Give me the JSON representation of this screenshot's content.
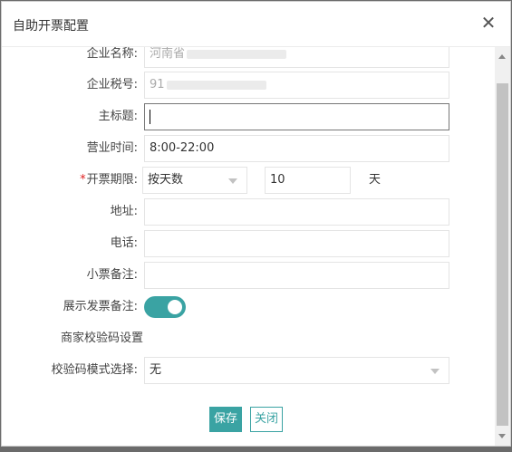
{
  "dialog": {
    "title": "自助开票配置",
    "close_icon": "✕"
  },
  "form": {
    "company_name": {
      "label": "企业名称:",
      "value": "河南省",
      "disabled": true
    },
    "tax_number": {
      "label": "企业税号:",
      "value": "91",
      "disabled": true
    },
    "main_title": {
      "label": "主标题:",
      "value": ""
    },
    "business_hours": {
      "label": "营业时间:",
      "value": "8:00-22:00"
    },
    "invoice_period": {
      "required_mark": "*",
      "label": "开票期限:",
      "mode": "按天数",
      "count": "10",
      "unit": "天"
    },
    "address": {
      "label": "地址:",
      "value": ""
    },
    "phone": {
      "label": "电话:",
      "value": ""
    },
    "receipt_note": {
      "label": "小票备注:",
      "value": ""
    },
    "show_invoice_note": {
      "label": "展示发票备注:",
      "on": true
    },
    "merchant_code_section": "商家校验码设置",
    "code_mode": {
      "label": "校验码模式选择:",
      "value": "无"
    }
  },
  "buttons": {
    "save": "保存",
    "close": "关闭"
  },
  "colors": {
    "accent": "#3aa3a3",
    "required": "#e02020"
  }
}
